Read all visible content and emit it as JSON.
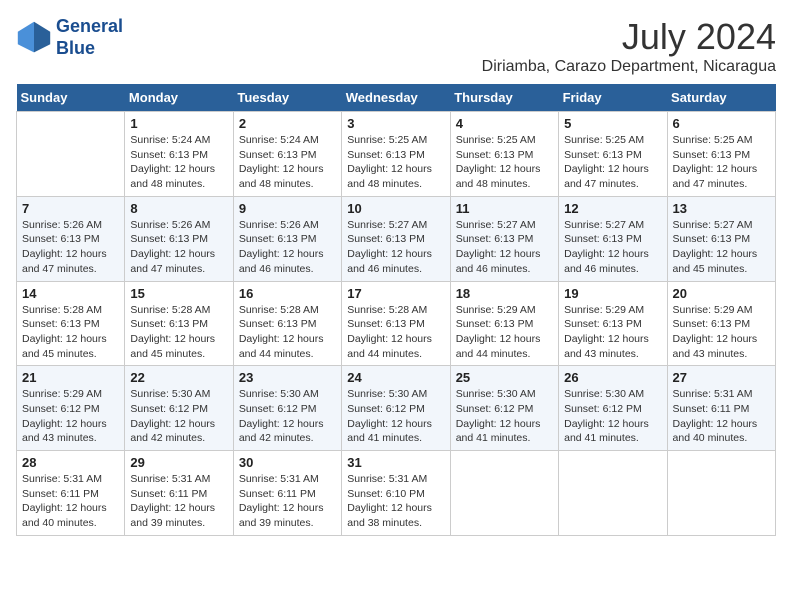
{
  "header": {
    "logo_line1": "General",
    "logo_line2": "Blue",
    "month": "July 2024",
    "location": "Diriamba, Carazo Department, Nicaragua"
  },
  "weekdays": [
    "Sunday",
    "Monday",
    "Tuesday",
    "Wednesday",
    "Thursday",
    "Friday",
    "Saturday"
  ],
  "weeks": [
    [
      {
        "day": "",
        "info": ""
      },
      {
        "day": "1",
        "info": "Sunrise: 5:24 AM\nSunset: 6:13 PM\nDaylight: 12 hours\nand 48 minutes."
      },
      {
        "day": "2",
        "info": "Sunrise: 5:24 AM\nSunset: 6:13 PM\nDaylight: 12 hours\nand 48 minutes."
      },
      {
        "day": "3",
        "info": "Sunrise: 5:25 AM\nSunset: 6:13 PM\nDaylight: 12 hours\nand 48 minutes."
      },
      {
        "day": "4",
        "info": "Sunrise: 5:25 AM\nSunset: 6:13 PM\nDaylight: 12 hours\nand 48 minutes."
      },
      {
        "day": "5",
        "info": "Sunrise: 5:25 AM\nSunset: 6:13 PM\nDaylight: 12 hours\nand 47 minutes."
      },
      {
        "day": "6",
        "info": "Sunrise: 5:25 AM\nSunset: 6:13 PM\nDaylight: 12 hours\nand 47 minutes."
      }
    ],
    [
      {
        "day": "7",
        "info": "Sunrise: 5:26 AM\nSunset: 6:13 PM\nDaylight: 12 hours\nand 47 minutes."
      },
      {
        "day": "8",
        "info": "Sunrise: 5:26 AM\nSunset: 6:13 PM\nDaylight: 12 hours\nand 47 minutes."
      },
      {
        "day": "9",
        "info": "Sunrise: 5:26 AM\nSunset: 6:13 PM\nDaylight: 12 hours\nand 46 minutes."
      },
      {
        "day": "10",
        "info": "Sunrise: 5:27 AM\nSunset: 6:13 PM\nDaylight: 12 hours\nand 46 minutes."
      },
      {
        "day": "11",
        "info": "Sunrise: 5:27 AM\nSunset: 6:13 PM\nDaylight: 12 hours\nand 46 minutes."
      },
      {
        "day": "12",
        "info": "Sunrise: 5:27 AM\nSunset: 6:13 PM\nDaylight: 12 hours\nand 46 minutes."
      },
      {
        "day": "13",
        "info": "Sunrise: 5:27 AM\nSunset: 6:13 PM\nDaylight: 12 hours\nand 45 minutes."
      }
    ],
    [
      {
        "day": "14",
        "info": "Sunrise: 5:28 AM\nSunset: 6:13 PM\nDaylight: 12 hours\nand 45 minutes."
      },
      {
        "day": "15",
        "info": "Sunrise: 5:28 AM\nSunset: 6:13 PM\nDaylight: 12 hours\nand 45 minutes."
      },
      {
        "day": "16",
        "info": "Sunrise: 5:28 AM\nSunset: 6:13 PM\nDaylight: 12 hours\nand 44 minutes."
      },
      {
        "day": "17",
        "info": "Sunrise: 5:28 AM\nSunset: 6:13 PM\nDaylight: 12 hours\nand 44 minutes."
      },
      {
        "day": "18",
        "info": "Sunrise: 5:29 AM\nSunset: 6:13 PM\nDaylight: 12 hours\nand 44 minutes."
      },
      {
        "day": "19",
        "info": "Sunrise: 5:29 AM\nSunset: 6:13 PM\nDaylight: 12 hours\nand 43 minutes."
      },
      {
        "day": "20",
        "info": "Sunrise: 5:29 AM\nSunset: 6:13 PM\nDaylight: 12 hours\nand 43 minutes."
      }
    ],
    [
      {
        "day": "21",
        "info": "Sunrise: 5:29 AM\nSunset: 6:12 PM\nDaylight: 12 hours\nand 43 minutes."
      },
      {
        "day": "22",
        "info": "Sunrise: 5:30 AM\nSunset: 6:12 PM\nDaylight: 12 hours\nand 42 minutes."
      },
      {
        "day": "23",
        "info": "Sunrise: 5:30 AM\nSunset: 6:12 PM\nDaylight: 12 hours\nand 42 minutes."
      },
      {
        "day": "24",
        "info": "Sunrise: 5:30 AM\nSunset: 6:12 PM\nDaylight: 12 hours\nand 41 minutes."
      },
      {
        "day": "25",
        "info": "Sunrise: 5:30 AM\nSunset: 6:12 PM\nDaylight: 12 hours\nand 41 minutes."
      },
      {
        "day": "26",
        "info": "Sunrise: 5:30 AM\nSunset: 6:12 PM\nDaylight: 12 hours\nand 41 minutes."
      },
      {
        "day": "27",
        "info": "Sunrise: 5:31 AM\nSunset: 6:11 PM\nDaylight: 12 hours\nand 40 minutes."
      }
    ],
    [
      {
        "day": "28",
        "info": "Sunrise: 5:31 AM\nSunset: 6:11 PM\nDaylight: 12 hours\nand 40 minutes."
      },
      {
        "day": "29",
        "info": "Sunrise: 5:31 AM\nSunset: 6:11 PM\nDaylight: 12 hours\nand 39 minutes."
      },
      {
        "day": "30",
        "info": "Sunrise: 5:31 AM\nSunset: 6:11 PM\nDaylight: 12 hours\nand 39 minutes."
      },
      {
        "day": "31",
        "info": "Sunrise: 5:31 AM\nSunset: 6:10 PM\nDaylight: 12 hours\nand 38 minutes."
      },
      {
        "day": "",
        "info": ""
      },
      {
        "day": "",
        "info": ""
      },
      {
        "day": "",
        "info": ""
      }
    ]
  ]
}
